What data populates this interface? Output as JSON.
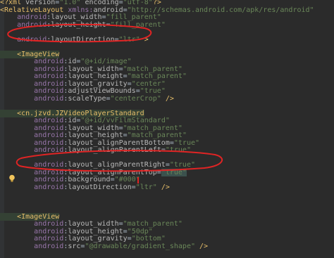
{
  "colors": {
    "background": "#2b2b2b",
    "tag": "#e8bf6a",
    "namespace": "#9876aa",
    "attribute": "#bababa",
    "value": "#6a8759",
    "text": "#a9b7c6",
    "annotation_red": "#e02424",
    "bulb": "#f2c55c"
  },
  "icons": {
    "intention_bulb": "lightbulb-icon"
  },
  "lines": [
    [
      [
        "c-pi",
        "<?xml "
      ],
      [
        "c-attr",
        "version"
      ],
      [
        "c-punc",
        "="
      ],
      [
        "c-val",
        "\"1.0\""
      ],
      [
        "c-punc",
        " "
      ],
      [
        "c-attr",
        "encoding"
      ],
      [
        "c-punc",
        "="
      ],
      [
        "c-val",
        "\"utf-8\""
      ],
      [
        "c-pi",
        "?>"
      ]
    ],
    [
      [
        "c-tag",
        "<RelativeLayout "
      ],
      [
        "c-ns",
        "xmlns:"
      ],
      [
        "c-attr",
        "android"
      ],
      [
        "c-punc",
        "="
      ],
      [
        "c-val",
        "\"http://schemas.android.com/apk/res/android\""
      ]
    ],
    [
      [
        "c-text",
        "    "
      ],
      [
        "c-ns",
        "android"
      ],
      [
        "c-punc",
        ":"
      ],
      [
        "c-attr",
        "layout_width"
      ],
      [
        "c-punc",
        "="
      ],
      [
        "c-val",
        "\"fill_parent\""
      ]
    ],
    [
      [
        "c-text",
        "    "
      ],
      [
        "c-ns",
        "android"
      ],
      [
        "c-punc",
        ":"
      ],
      [
        "c-attr",
        "layout_height"
      ],
      [
        "c-punc",
        "="
      ],
      [
        "c-val",
        "\"fill_parent\""
      ]
    ],
    [
      [
        "c-text",
        ""
      ]
    ],
    [
      [
        "c-text",
        "    "
      ],
      [
        "c-ns",
        "android"
      ],
      [
        "c-punc",
        ":"
      ],
      [
        "c-attr",
        "layoutDirection"
      ],
      [
        "c-punc",
        "="
      ],
      [
        "c-val",
        "\"ltr\""
      ],
      [
        "c-tag",
        " >"
      ]
    ],
    [
      [
        "c-text",
        ""
      ]
    ],
    [
      [
        "c-tag",
        "    <ImageView"
      ]
    ],
    [
      [
        "c-text",
        "        "
      ],
      [
        "c-ns",
        "android"
      ],
      [
        "c-punc",
        ":"
      ],
      [
        "c-attr",
        "id"
      ],
      [
        "c-punc",
        "="
      ],
      [
        "c-val",
        "\"@+id/image\""
      ]
    ],
    [
      [
        "c-text",
        "        "
      ],
      [
        "c-ns",
        "android"
      ],
      [
        "c-punc",
        ":"
      ],
      [
        "c-attr",
        "layout_width"
      ],
      [
        "c-punc",
        "="
      ],
      [
        "c-val",
        "\"match_parent\""
      ]
    ],
    [
      [
        "c-text",
        "        "
      ],
      [
        "c-ns",
        "android"
      ],
      [
        "c-punc",
        ":"
      ],
      [
        "c-attr",
        "layout_height"
      ],
      [
        "c-punc",
        "="
      ],
      [
        "c-val",
        "\"match_parent\""
      ]
    ],
    [
      [
        "c-text",
        "        "
      ],
      [
        "c-ns",
        "android"
      ],
      [
        "c-punc",
        ":"
      ],
      [
        "c-attr",
        "layout_gravity"
      ],
      [
        "c-punc",
        "="
      ],
      [
        "c-val",
        "\"center\""
      ]
    ],
    [
      [
        "c-text",
        "        "
      ],
      [
        "c-ns",
        "android"
      ],
      [
        "c-punc",
        ":"
      ],
      [
        "c-attr",
        "adjustViewBounds"
      ],
      [
        "c-punc",
        "="
      ],
      [
        "c-val",
        "\"true\""
      ]
    ],
    [
      [
        "c-text",
        "        "
      ],
      [
        "c-ns",
        "android"
      ],
      [
        "c-punc",
        ":"
      ],
      [
        "c-attr",
        "scaleType"
      ],
      [
        "c-punc",
        "="
      ],
      [
        "c-val",
        "\"centerCrop\""
      ],
      [
        "c-tag",
        " />"
      ]
    ],
    [
      [
        "c-text",
        ""
      ]
    ],
    [
      [
        "c-tag",
        "    <cn.jzvd.JZVideoPlayerStandard"
      ]
    ],
    [
      [
        "c-text",
        "        "
      ],
      [
        "c-ns",
        "android"
      ],
      [
        "c-punc",
        ":"
      ],
      [
        "c-attr",
        "id"
      ],
      [
        "c-punc",
        "="
      ],
      [
        "c-val",
        "\"@+id/vvFilmStandard\""
      ]
    ],
    [
      [
        "c-text",
        "        "
      ],
      [
        "c-ns",
        "android"
      ],
      [
        "c-punc",
        ":"
      ],
      [
        "c-attr",
        "layout_width"
      ],
      [
        "c-punc",
        "="
      ],
      [
        "c-val",
        "\"match_parent\""
      ]
    ],
    [
      [
        "c-text",
        "        "
      ],
      [
        "c-ns",
        "android"
      ],
      [
        "c-punc",
        ":"
      ],
      [
        "c-attr",
        "layout_height"
      ],
      [
        "c-punc",
        "="
      ],
      [
        "c-val",
        "\"match_parent\""
      ]
    ],
    [
      [
        "c-text",
        "        "
      ],
      [
        "c-ns",
        "android"
      ],
      [
        "c-punc",
        ":"
      ],
      [
        "c-attr",
        "layout_alignParentBottom"
      ],
      [
        "c-punc",
        "="
      ],
      [
        "c-val",
        "\"true\""
      ]
    ],
    [
      [
        "c-text",
        "        "
      ],
      [
        "c-ns",
        "android"
      ],
      [
        "c-punc",
        ":"
      ],
      [
        "c-attr",
        "layout_alignParentLeft"
      ],
      [
        "c-punc",
        "="
      ],
      [
        "c-val",
        "\"true\""
      ]
    ],
    [
      [
        "c-text",
        ""
      ]
    ],
    [
      [
        "c-text",
        "        "
      ],
      [
        "c-ns",
        "android"
      ],
      [
        "c-punc",
        ":"
      ],
      [
        "c-attr",
        "layout_alignParentRight"
      ],
      [
        "c-punc",
        "="
      ],
      [
        "c-val",
        "\"true\""
      ]
    ],
    [
      [
        "c-text",
        "        "
      ],
      [
        "c-ns",
        "android"
      ],
      [
        "c-punc",
        ":"
      ],
      [
        "c-attr",
        "layout_alignParentTop"
      ],
      [
        "c-punc",
        "="
      ],
      [
        "c-val",
        "\"true\""
      ]
    ],
    [
      [
        "c-text",
        "        "
      ],
      [
        "c-ns",
        "android"
      ],
      [
        "c-punc",
        ":"
      ],
      [
        "c-attr",
        "background"
      ],
      [
        "c-punc",
        "="
      ],
      [
        "c-val",
        "\"#000\""
      ]
    ],
    [
      [
        "c-text",
        "        "
      ],
      [
        "c-ns",
        "android"
      ],
      [
        "c-punc",
        ":"
      ],
      [
        "c-attr",
        "layoutDirection"
      ],
      [
        "c-punc",
        "="
      ],
      [
        "c-val",
        "\"ltr\""
      ],
      [
        "c-tag",
        " />"
      ]
    ],
    [
      [
        "c-text",
        ""
      ]
    ],
    [
      [
        "c-text",
        ""
      ]
    ],
    [
      [
        "c-text",
        ""
      ]
    ],
    [
      [
        "c-tag",
        "    <ImageView"
      ]
    ],
    [
      [
        "c-text",
        "        "
      ],
      [
        "c-ns",
        "android"
      ],
      [
        "c-punc",
        ":"
      ],
      [
        "c-attr",
        "layout_width"
      ],
      [
        "c-punc",
        "="
      ],
      [
        "c-val",
        "\"match_parent\""
      ]
    ],
    [
      [
        "c-text",
        "        "
      ],
      [
        "c-ns",
        "android"
      ],
      [
        "c-punc",
        ":"
      ],
      [
        "c-attr",
        "layout_height"
      ],
      [
        "c-punc",
        "="
      ],
      [
        "c-val",
        "\"50dp\""
      ]
    ],
    [
      [
        "c-text",
        "        "
      ],
      [
        "c-ns",
        "android"
      ],
      [
        "c-punc",
        ":"
      ],
      [
        "c-attr",
        "layout_gravity"
      ],
      [
        "c-punc",
        "="
      ],
      [
        "c-val",
        "\"bottom\""
      ]
    ],
    [
      [
        "c-text",
        "        "
      ],
      [
        "c-ns",
        "android"
      ],
      [
        "c-punc",
        ":"
      ],
      [
        "c-attr",
        "src"
      ],
      [
        "c-punc",
        "="
      ],
      [
        "c-val",
        "\"@drawable/gradient_shape\""
      ],
      [
        "c-tag",
        " />"
      ]
    ],
    [
      [
        "c-text",
        ""
      ]
    ]
  ]
}
